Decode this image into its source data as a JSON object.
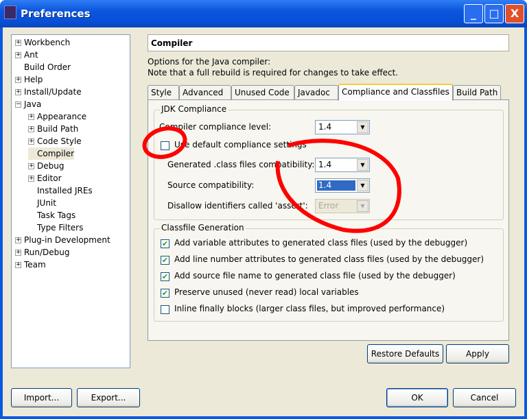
{
  "window": {
    "title": "Preferences",
    "minimize": "_",
    "maximize": "□",
    "close": "X"
  },
  "tree": [
    {
      "label": "Workbench",
      "toggle": "+",
      "level": 0
    },
    {
      "label": "Ant",
      "toggle": "+",
      "level": 0
    },
    {
      "label": "Build Order",
      "toggle": "",
      "level": 0
    },
    {
      "label": "Help",
      "toggle": "+",
      "level": 0
    },
    {
      "label": "Install/Update",
      "toggle": "+",
      "level": 0
    },
    {
      "label": "Java",
      "toggle": "-",
      "level": 0
    },
    {
      "label": "Appearance",
      "toggle": "+",
      "level": 1
    },
    {
      "label": "Build Path",
      "toggle": "+",
      "level": 1
    },
    {
      "label": "Code Style",
      "toggle": "+",
      "level": 1
    },
    {
      "label": "Compiler",
      "toggle": "",
      "level": 1,
      "selected": true
    },
    {
      "label": "Debug",
      "toggle": "+",
      "level": 1
    },
    {
      "label": "Editor",
      "toggle": "+",
      "level": 1
    },
    {
      "label": "Installed JREs",
      "toggle": "",
      "level": 1
    },
    {
      "label": "JUnit",
      "toggle": "",
      "level": 1
    },
    {
      "label": "Task Tags",
      "toggle": "",
      "level": 1
    },
    {
      "label": "Type Filters",
      "toggle": "",
      "level": 1
    },
    {
      "label": "Plug-in Development",
      "toggle": "+",
      "level": 0
    },
    {
      "label": "Run/Debug",
      "toggle": "+",
      "level": 0
    },
    {
      "label": "Team",
      "toggle": "+",
      "level": 0
    }
  ],
  "page": {
    "title": "Compiler",
    "desc1": "Options for the Java compiler:",
    "desc2": "Note that a full rebuild is required for changes to take effect."
  },
  "tabs": [
    "Style",
    "Advanced",
    "Unused Code",
    "Javadoc",
    "Compliance and Classfiles",
    "Build Path"
  ],
  "jdk": {
    "title": "JDK Compliance",
    "compliance_label": "Compiler compliance level:",
    "compliance_value": "1.4",
    "use_default_label": "Use default compliance settings",
    "use_default_checked": false,
    "generated_label": "Generated .class files compatibility:",
    "generated_value": "1.4",
    "source_label": "Source compatibility:",
    "source_value": "1.4",
    "assert_label": "Disallow identifiers called 'assert':",
    "assert_value": "Error"
  },
  "classfile": {
    "title": "Classfile Generation",
    "options": [
      {
        "label": "Add variable attributes to generated class files (used by the debugger)",
        "checked": true,
        "mark": "✔"
      },
      {
        "label": "Add line number attributes to generated class files (used by the debugger)",
        "checked": true,
        "mark": "✔"
      },
      {
        "label": "Add source file name to generated class file (used by the debugger)",
        "checked": true,
        "mark": "✔"
      },
      {
        "label": "Preserve unused (never read) local variables",
        "checked": true,
        "mark": "✔"
      },
      {
        "label": "Inline finally blocks (larger class files, but improved performance)",
        "checked": false,
        "mark": ""
      }
    ]
  },
  "buttons": {
    "restore": "Restore Defaults",
    "apply": "Apply",
    "import": "Import...",
    "export": "Export...",
    "ok": "OK",
    "cancel": "Cancel"
  },
  "annotation_color": "#ff0000"
}
